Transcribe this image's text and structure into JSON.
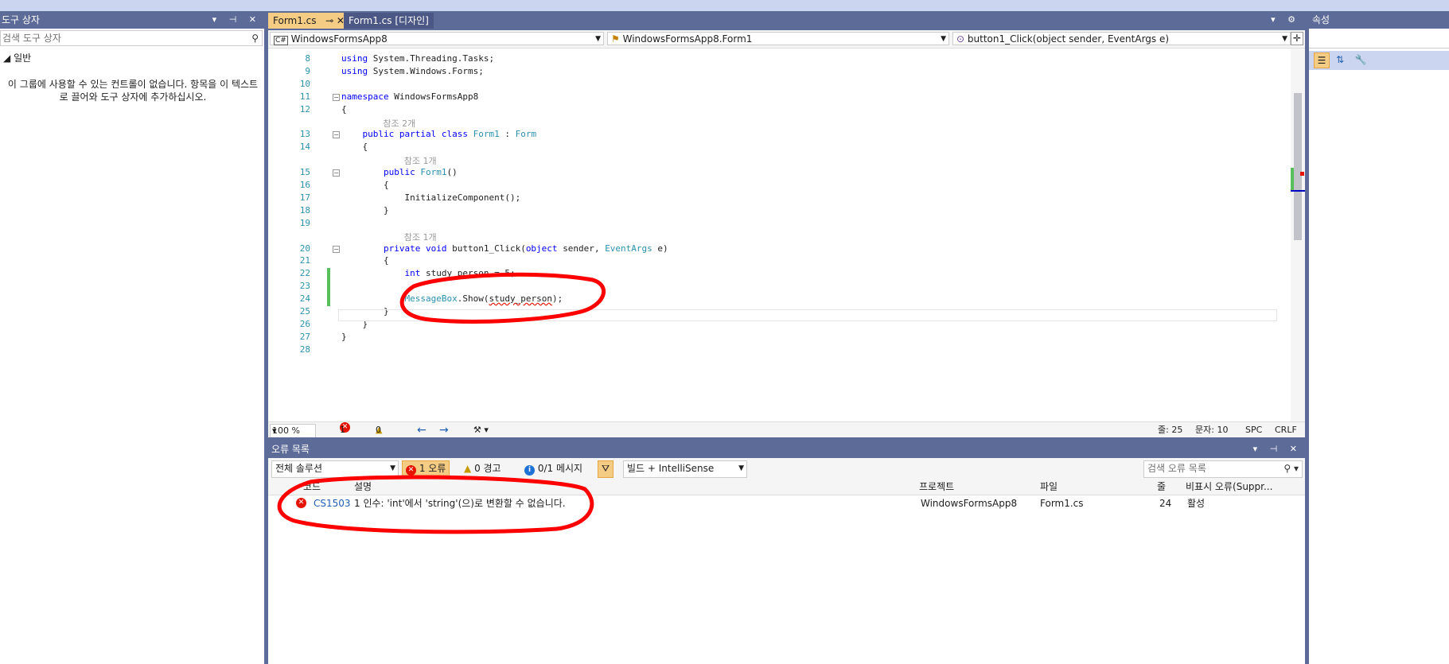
{
  "toolbox": {
    "title": "도구 상자",
    "search_placeholder": "검색 도구 상자",
    "group": "일반",
    "empty_message": "이 그룹에 사용할 수 있는 컨트롤이 없습니다. 항목을 이 텍스트로 끌어와 도구 상자에 추가하십시오."
  },
  "editor": {
    "tabs": [
      {
        "label": "Form1.cs",
        "active": true
      },
      {
        "label": "Form1.cs [디자인]",
        "active": false
      }
    ],
    "nav": {
      "project": "WindowsFormsApp8",
      "class": "WindowsFormsApp8.Form1",
      "member": "button1_Click(object sender, EventArgs e)"
    },
    "lines": [
      {
        "n": "8",
        "code": "using System.Threading.Tasks;"
      },
      {
        "n": "9",
        "code": "using System.Windows.Forms;"
      },
      {
        "n": "10",
        "code": ""
      },
      {
        "n": "11",
        "code": "namespace WindowsFormsApp8"
      },
      {
        "n": "12",
        "code": "{"
      },
      {
        "n": "13",
        "code": "    public partial class Form1 : Form"
      },
      {
        "n": "14",
        "code": "    {"
      },
      {
        "n": "15",
        "code": "        public Form1()"
      },
      {
        "n": "16",
        "code": "        {"
      },
      {
        "n": "17",
        "code": "            InitializeComponent();"
      },
      {
        "n": "18",
        "code": "        }"
      },
      {
        "n": "19",
        "code": ""
      },
      {
        "n": "20",
        "code": "        private void button1_Click(object sender, EventArgs e)"
      },
      {
        "n": "21",
        "code": "        {"
      },
      {
        "n": "22",
        "code": "            int study_person = 5;"
      },
      {
        "n": "23",
        "code": ""
      },
      {
        "n": "24",
        "code": "            MessageBox.Show(study_person);"
      },
      {
        "n": "25",
        "code": "        }"
      },
      {
        "n": "26",
        "code": "    }"
      },
      {
        "n": "27",
        "code": "}"
      },
      {
        "n": "28",
        "code": ""
      }
    ],
    "refs": {
      "class_ref": "참조 2개",
      "ctor_ref": "참조 1개",
      "method_ref": "참조 1개"
    },
    "status": {
      "zoom": "100 %",
      "errors": "1",
      "warnings": "0",
      "line": "줄: 25",
      "char": "문자: 10",
      "spc": "SPC",
      "eol": "CRLF"
    }
  },
  "error_list": {
    "title": "오류 목록",
    "scope": "전체 솔루션",
    "errors_btn": "1 오류",
    "warnings_btn": "0 경고",
    "messages_btn": "0/1 메시지",
    "build_filter": "빌드 + IntelliSense",
    "search_placeholder": "검색 오류 목록",
    "headers": {
      "code": "코드",
      "desc": "설명",
      "project": "프로젝트",
      "file": "파일",
      "line": "줄",
      "suppress": "비표시 오류(Suppr..."
    },
    "rows": [
      {
        "code": "CS1503",
        "desc": "1 인수: 'int'에서 'string'(으)로 변환할 수 없습니다.",
        "project": "WindowsFormsApp8",
        "file": "Form1.cs",
        "line": "24",
        "state": "활성"
      }
    ]
  },
  "properties": {
    "title": "속성"
  },
  "colors": {
    "accent": "#5d6b99",
    "active_tab": "#f5cc84",
    "error": "#e51400",
    "annotation": "#ff0000"
  }
}
